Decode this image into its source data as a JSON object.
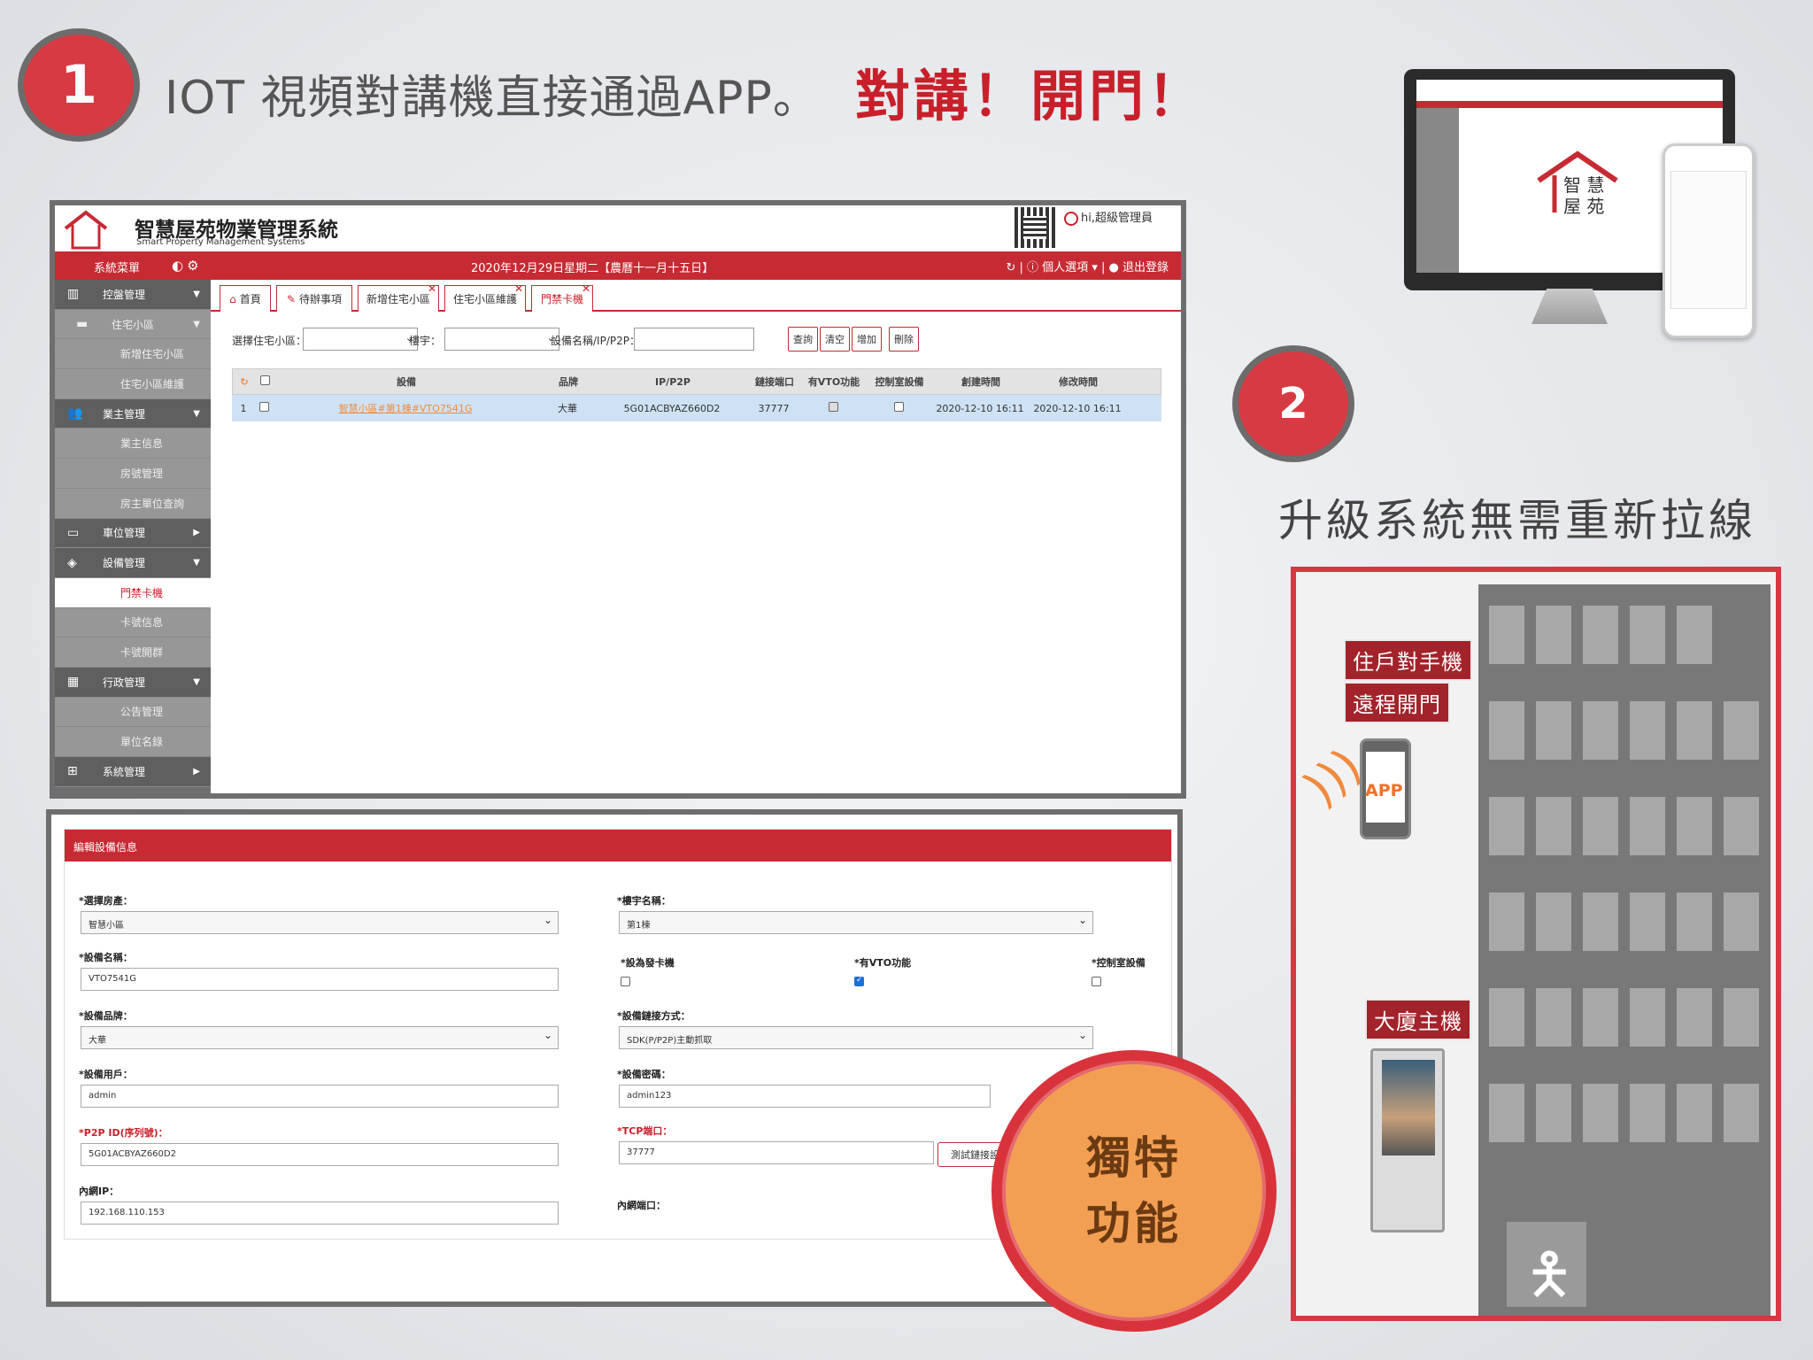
{
  "heading": {
    "badge1": "1",
    "headline": "IOT 視頻對講機直接通過APP。",
    "tagline": "對講！開門！"
  },
  "system": {
    "logo_text": "智慧\n屋苑",
    "title": "智慧屋苑物業管理系統",
    "subtitle": "Smart Property Management Systems",
    "user_greeting": "hi,超級管理員",
    "menu_label": "系統菜單",
    "date": "2020年12月29日星期二【農曆十一月十五日】",
    "top_personal": "個人選項",
    "top_logout": "退出登錄",
    "sidebar": [
      {
        "label": "控盤管理",
        "type": "group",
        "icon": "chart-icon"
      },
      {
        "label": "住宅小區",
        "type": "sub2",
        "icon": "folder-icon"
      },
      {
        "label": "新增住宅小區",
        "type": "sub"
      },
      {
        "label": "住宅小區維護",
        "type": "sub"
      },
      {
        "label": "業主管理",
        "type": "group",
        "icon": "users-icon"
      },
      {
        "label": "業主信息",
        "type": "sub"
      },
      {
        "label": "房號管理",
        "type": "sub"
      },
      {
        "label": "房主單位查詢",
        "type": "sub"
      },
      {
        "label": "車位管理",
        "type": "group",
        "icon": "car-icon"
      },
      {
        "label": "設備管理",
        "type": "group",
        "icon": "cube-icon"
      },
      {
        "label": "門禁卡機",
        "type": "active"
      },
      {
        "label": "卡號信息",
        "type": "sub"
      },
      {
        "label": "卡號開群",
        "type": "sub"
      },
      {
        "label": "行政管理",
        "type": "group",
        "icon": "calendar-icon"
      },
      {
        "label": "公告管理",
        "type": "sub"
      },
      {
        "label": "單位名錄",
        "type": "sub"
      },
      {
        "label": "系統管理",
        "type": "group",
        "icon": "windows-icon"
      }
    ],
    "tabs": [
      "首頁",
      "待辦事項",
      "新增住宅小區",
      "住宅小區維護",
      "門禁卡機"
    ],
    "filters": {
      "estate_label": "選擇住宅小區：",
      "building_label": "樓宇：",
      "device_label": "設備名稱/IP/P2P：",
      "btn_query": "查詢",
      "btn_clear": "清空",
      "btn_add": "增加",
      "btn_delete": "刪除"
    },
    "grid": {
      "headers": [
        "設備",
        "品牌",
        "IP/P2P",
        "鏈接端口",
        "有VTO功能",
        "控制室設備",
        "創建時間",
        "修改時間"
      ],
      "rows": [
        [
          "1",
          "智慧小區#第1棟#VTO7541G",
          "大華",
          "5G01ACBYAZ660D2",
          "37777",
          "2020-12-10 16:11",
          "2020-12-10 16:11"
        ]
      ]
    }
  },
  "form": {
    "title": "編輯設備信息",
    "estate_label": "*選擇房產：",
    "estate_value": "智慧小區",
    "building_label": "*樓宇名稱：",
    "building_value": "第1棟",
    "name_label": "*設備名稱：",
    "name_value": "VTO7541G",
    "card_label": "*設為發卡機",
    "vto_label": "*有VTO功能",
    "control_label": "*控制室設備",
    "brand_label": "*設備品牌：",
    "brand_value": "大華",
    "conn_label": "*設備鏈接方式：",
    "conn_value": "SDK(P/P2P)主動抓取",
    "user_label": "*設備用戶：",
    "user_value": "admin",
    "pwd_label": "*設備密碼：",
    "pwd_value": "admin123",
    "p2p_label": "*P2P ID(序列號)：",
    "p2p_value": "5G01ACBYAZ660D2",
    "tcp_label": "*TCP端口：",
    "tcp_value": "37777",
    "test_btn": "測試鏈接設備",
    "lan_ip_label": "內網IP：",
    "lan_ip_value": "192.168.110.153",
    "lan_port_label": "內網端口："
  },
  "unique": {
    "line1": "獨特",
    "line2": "功能"
  },
  "section2": {
    "badge": "2",
    "upgrade": "升級系統無需重新拉線",
    "resident_phone": "住戶對手機",
    "remote_open": "遠程開門",
    "app": "APP",
    "main_unit": "大廈主機",
    "logo_text": "智慧\n屋苑"
  },
  "colors": {
    "brand_red": "#c62a33",
    "badge_orange": "#f39f53",
    "accent_orange": "#f0722a"
  }
}
